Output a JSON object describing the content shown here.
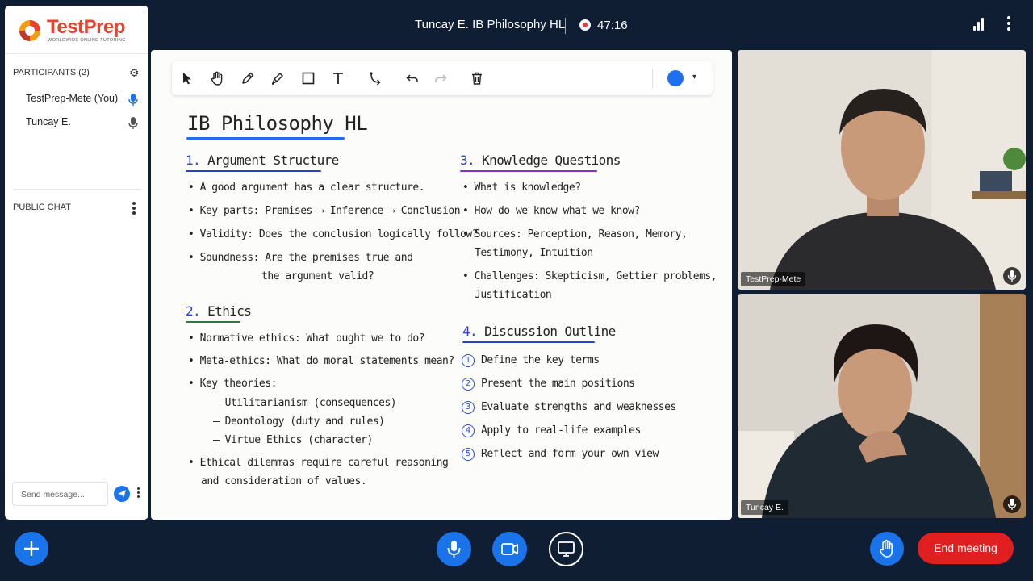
{
  "header": {
    "meeting_title": "Tuncay E. IB Philosophy HL",
    "timer": "47:16"
  },
  "brand": {
    "name": "TestPrep",
    "tagline": "WORLDWIDE ONLINE TUTORING"
  },
  "sidebar": {
    "participants_heading": "PARTICIPANTS (2)",
    "participants": [
      {
        "name": "TestPrep-Mete (You)",
        "mic": "active"
      },
      {
        "name": "Tuncay E.",
        "mic": "idle"
      }
    ],
    "chat_heading": "PUBLIC CHAT",
    "chat_placeholder": "Send message..."
  },
  "whiteboard": {
    "title": "IB Philosophy HL",
    "pen_color": "#1f6ff0",
    "sections": {
      "s1": {
        "num": "1.",
        "title": "Argument Structure",
        "bullets": [
          "A good argument has a clear structure.",
          "Key parts: Premises → Inference → Conclusion",
          "Validity: Does the conclusion logically follow?",
          "Soundness: Are the premises true and",
          "the argument valid?"
        ]
      },
      "s2": {
        "num": "2.",
        "title": "Ethics",
        "bullets": [
          "Normative ethics: What ought we to do?",
          "Meta-ethics: What do moral statements mean?",
          "Key theories:",
          "– Utilitarianism (consequences)",
          "– Deontology (duty and rules)",
          "– Virtue Ethics (character)",
          "Ethical dilemmas require careful reasoning",
          "and consideration of values."
        ]
      },
      "s3": {
        "num": "3.",
        "title": "Knowledge Questions",
        "bullets": [
          "What is knowledge?",
          "How do we know what we know?",
          "Sources: Perception, Reason, Memory,",
          "Testimony, Intuition",
          "Challenges: Skepticism, Gettier problems,",
          "Justification"
        ]
      },
      "s4": {
        "num": "4.",
        "title": "Discussion Outline",
        "steps": [
          {
            "n": "1",
            "text": "Define the key terms"
          },
          {
            "n": "2",
            "text": "Present the main positions"
          },
          {
            "n": "3",
            "text": "Evaluate strengths and weaknesses"
          },
          {
            "n": "4",
            "text": "Apply to real-life examples"
          },
          {
            "n": "5",
            "text": "Reflect and form your own view"
          }
        ]
      }
    }
  },
  "videos": [
    {
      "label": "TestPrep-Mete"
    },
    {
      "label": "Tuncay E."
    }
  ],
  "controls": {
    "end_label": "End meeting"
  },
  "colors": {
    "accent": "#1a73e8",
    "end": "#e02020",
    "background": "#0f1e33",
    "recording": "#e53935"
  }
}
